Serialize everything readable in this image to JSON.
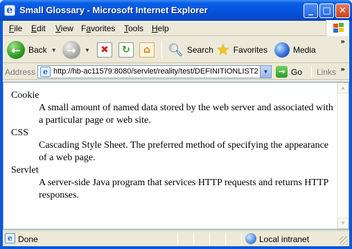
{
  "window": {
    "title": "Small Glossary - Microsoft Internet Explorer",
    "controls": {
      "minimize": "_",
      "maximize": "□",
      "close": "✕"
    }
  },
  "menu": {
    "items": [
      {
        "label": "File",
        "mnemonic": "F"
      },
      {
        "label": "Edit",
        "mnemonic": "E"
      },
      {
        "label": "View",
        "mnemonic": "V"
      },
      {
        "label": "Favorites",
        "mnemonic": "a"
      },
      {
        "label": "Tools",
        "mnemonic": "T"
      },
      {
        "label": "Help",
        "mnemonic": "H"
      }
    ]
  },
  "toolbar": {
    "back_label": "Back",
    "search_label": "Search",
    "favorites_label": "Favorites",
    "media_label": "Media",
    "overflow": "»"
  },
  "address_bar": {
    "label": "Address",
    "url": "http://hb-ac11579:8080/servlet/reality/test/DEFINITIONLIST2",
    "go_label": "Go",
    "links_label": "Links",
    "links_overflow": "»"
  },
  "glossary": [
    {
      "term": "Cookie",
      "definition": "A small amount of named data stored by the web server and associated with a particular page or web site."
    },
    {
      "term": "CSS",
      "definition": "Cascading Style Sheet. The preferred method of specifying the appearance of a web page."
    },
    {
      "term": "Servlet",
      "definition": "A server-side Java program that services HTTP requests and returns HTTP responses."
    }
  ],
  "status_bar": {
    "status_text": "Done",
    "zone_text": "Local intranet"
  }
}
